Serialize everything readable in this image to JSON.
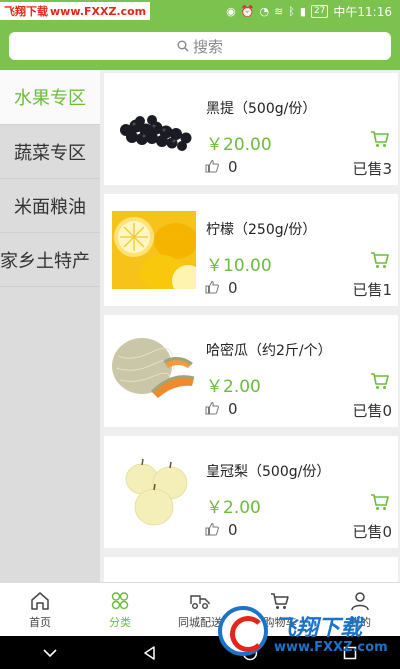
{
  "status_bar": {
    "watermark_left": "飞翔下载",
    "watermark_right": "www.FXXZ.com",
    "battery": "27",
    "time": "中午11:16"
  },
  "search": {
    "placeholder": "搜索"
  },
  "categories": [
    {
      "label": "水果专区",
      "active": true
    },
    {
      "label": "蔬菜专区",
      "active": false
    },
    {
      "label": "米面粮油",
      "active": false
    },
    {
      "label": "家乡土特产",
      "active": false
    }
  ],
  "products": [
    {
      "name": "黑提（500g/份）",
      "price": "￥20.00",
      "likes": "0",
      "sold": "已售3",
      "image": "black-grapes"
    },
    {
      "name": "柠檬（250g/份）",
      "price": "￥10.00",
      "likes": "0",
      "sold": "已售1",
      "image": "lemons"
    },
    {
      "name": "哈密瓜（约2斤/个）",
      "price": "￥2.00",
      "likes": "0",
      "sold": "已售0",
      "image": "cantaloupe"
    },
    {
      "name": "皇冠梨（500g/份）",
      "price": "￥2.00",
      "likes": "0",
      "sold": "已售0",
      "image": "crown-pears"
    }
  ],
  "bottom_nav": [
    {
      "label": "首页",
      "icon": "home-icon",
      "active": false
    },
    {
      "label": "分类",
      "icon": "category-icon",
      "active": true
    },
    {
      "label": "同城配送",
      "icon": "delivery-icon",
      "active": false
    },
    {
      "label": "购物车",
      "icon": "cart-icon",
      "active": false
    },
    {
      "label": "我的",
      "icon": "user-icon",
      "active": false
    }
  ],
  "logo_watermark": {
    "text": "飞翔下载",
    "sub": "www.FXXZ.com"
  },
  "colors": {
    "brand_green": "#7cc24e",
    "price_green": "#6bbd3c",
    "sidebar_bg": "#dcdcdc"
  }
}
